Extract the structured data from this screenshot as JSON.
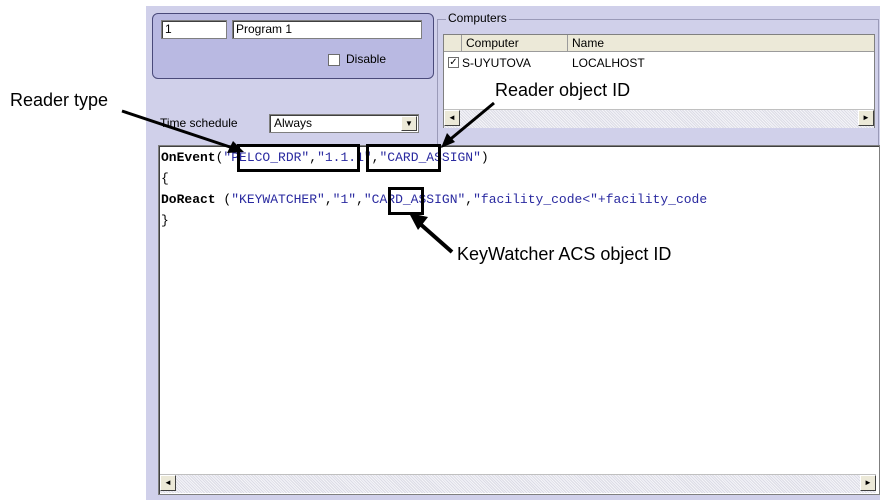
{
  "program": {
    "id_value": "1",
    "name_value": "Program 1",
    "disable_label": "Disable"
  },
  "computers": {
    "group_title": "Computers",
    "columns": [
      "Computer",
      "Name"
    ],
    "rows": [
      {
        "computer": "S-UYUTOVA",
        "name": "LOCALHOST",
        "checked": true
      }
    ]
  },
  "schedule": {
    "label": "Time schedule",
    "value": "Always"
  },
  "script": {
    "line1": {
      "kw": "OnEvent",
      "open": "(",
      "a1": "\"PELCO_RDR\"",
      "c1": ",",
      "a2": "\"1.1.1\"",
      "c2": ",",
      "a3": "\"CARD_ASSIGN\"",
      "close": ")"
    },
    "line2": "{",
    "line3": {
      "kw": "DoReact",
      "sp": " (",
      "a1": "\"KEYWATCHER\"",
      "c1": ",",
      "a2": "\"1\"",
      "c2": ",",
      "a3": "\"CARD_ASSIGN\"",
      "c3": ",",
      "a4": "\"facility_code<\"+facility_code"
    },
    "line4": "}"
  },
  "annotations": {
    "reader_type": "Reader type",
    "reader_object_id": "Reader object ID",
    "keywatcher_id": "KeyWatcher ACS object ID"
  },
  "scroll": {
    "left_arrow": "◄",
    "right_arrow": "►",
    "down_arrow": "▼"
  }
}
